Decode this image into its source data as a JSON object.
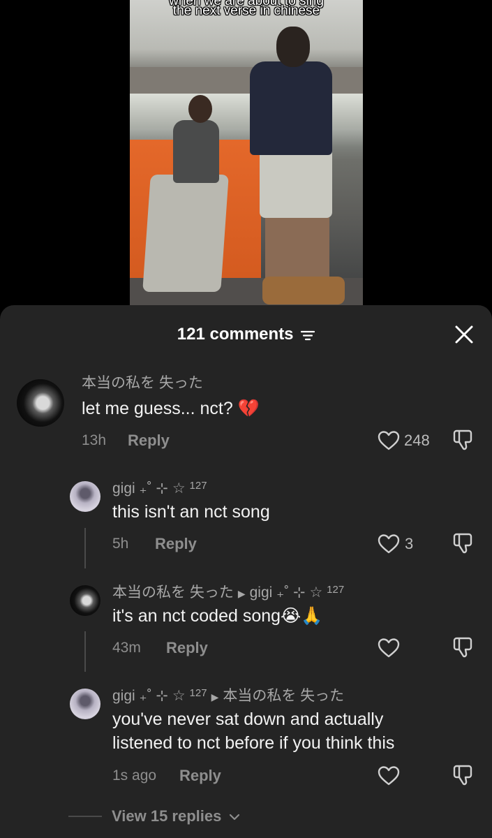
{
  "video": {
    "caption_line1": "when we are about to sing",
    "caption_line2": "the next verse in chinese"
  },
  "sheet": {
    "title": "121 comments",
    "sort_icon": "sort-lines-icon",
    "close_icon": "close-icon"
  },
  "comments": [
    {
      "username": "本当の私を 失った",
      "text": "let me guess... nct? ",
      "emoji": "💔",
      "time": "13h",
      "reply_label": "Reply",
      "likes": "248"
    },
    {
      "username": "gigi ₊˚ ⊹ ☆ ",
      "username_sup": "127",
      "text": "this isn't an nct song",
      "time": "5h",
      "reply_label": "Reply",
      "likes": "3"
    },
    {
      "username": "本当の私を 失った",
      "reply_to": "gigi ₊˚ ⊹ ☆ ",
      "reply_to_sup": "127",
      "text": "it's an nct coded song",
      "emoji": "😭🙏",
      "time": "43m",
      "reply_label": "Reply"
    },
    {
      "username": "gigi ₊˚ ⊹ ☆ ",
      "username_sup": "127",
      "reply_to": "本当の私を 失った",
      "text_line1": "you've never sat down and actually",
      "text_line2": "listened to nct before if you think this",
      "time": "1s ago",
      "reply_label": "Reply"
    }
  ],
  "view_replies": "View 15 replies"
}
